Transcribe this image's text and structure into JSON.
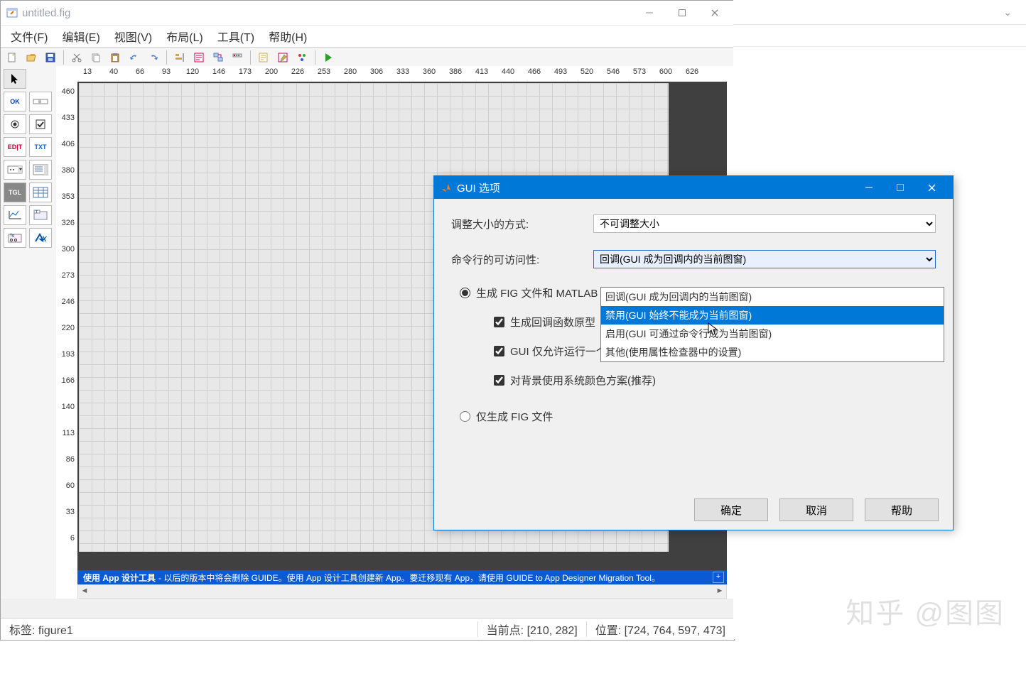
{
  "window": {
    "title": "untitled.fig"
  },
  "menu": [
    "文件(F)",
    "编辑(E)",
    "视图(V)",
    "布局(L)",
    "工具(T)",
    "帮助(H)"
  ],
  "ruler_h": [
    13,
    40,
    66,
    93,
    120,
    146,
    173,
    200,
    226,
    253,
    280,
    306,
    333,
    360,
    386,
    413,
    440,
    466,
    493,
    520,
    546,
    573,
    600,
    626
  ],
  "ruler_v": [
    460,
    433,
    406,
    380,
    353,
    326,
    300,
    273,
    246,
    220,
    193,
    166,
    140,
    113,
    86,
    60,
    33,
    6
  ],
  "app_banner": {
    "strong": "使用 App 设计工具",
    "rest": " - 以后的版本中将会删除 GUIDE。使用 App 设计工具创建新 App。要迁移现有 App，请使用 GUIDE to App Designer Migration Tool。"
  },
  "status": {
    "tag_label": "标签:",
    "tag_value": "figure1",
    "point_label": "当前点:",
    "point_value": "[210, 282]",
    "pos_label": "位置:",
    "pos_value": "[724, 764, 597, 473]"
  },
  "dialog": {
    "title": "GUI 选项",
    "resize_label": "调整大小的方式:",
    "resize_value": "不可调整大小",
    "cmd_label": "命令行的可访问性:",
    "cmd_value": "回调(GUI 成为回调内的当前图窗)",
    "radio1": "生成 FIG 文件和 MATLAB 文",
    "check1": "生成回调函数原型",
    "check2": "GUI 仅允许运行一个实例(单例)",
    "check3": "对背景使用系统颜色方案(推荐)",
    "radio2": "仅生成 FIG 文件",
    "options": [
      "回调(GUI 成为回调内的当前图窗)",
      "禁用(GUI 始终不能成为当前图窗)",
      "启用(GUI 可通过命令行成为当前图窗)",
      "其他(使用属性检查器中的设置)"
    ],
    "highlight_index": 1,
    "ok": "确定",
    "cancel": "取消",
    "help": "帮助"
  },
  "palette": [
    "OK",
    "SLD",
    "RB",
    "CB",
    "EDIT",
    "TXT",
    "POP",
    "LST",
    "TGL",
    "TBL",
    "AX",
    "PNL",
    "BTN",
    "X"
  ],
  "watermark": "知乎 @图图"
}
